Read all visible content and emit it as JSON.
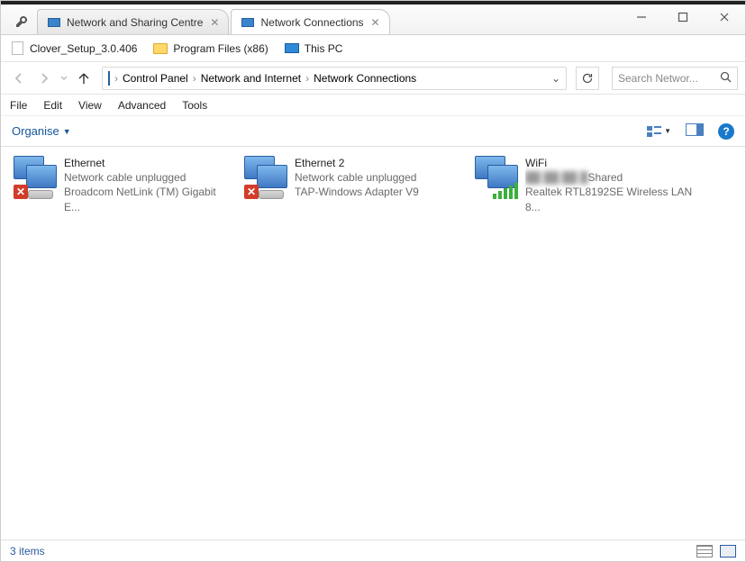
{
  "tabs": [
    {
      "label": "Network and Sharing Centre",
      "active": false
    },
    {
      "label": "Network Connections",
      "active": true
    }
  ],
  "bookmarks": [
    {
      "label": "Clover_Setup_3.0.406",
      "icon": "page"
    },
    {
      "label": "Program Files (x86)",
      "icon": "folder"
    },
    {
      "label": "This PC",
      "icon": "pc"
    }
  ],
  "breadcrumb": {
    "parts": [
      "Control Panel",
      "Network and Internet",
      "Network Connections"
    ]
  },
  "search": {
    "placeholder": "Search Networ..."
  },
  "menu": [
    "File",
    "Edit",
    "View",
    "Advanced",
    "Tools"
  ],
  "commandbar": {
    "organise": "Organise"
  },
  "help_symbol": "?",
  "connections": [
    {
      "name": "Ethernet",
      "status": "Network cable unplugged",
      "device": "Broadcom NetLink (TM) Gigabit E...",
      "state": "unplugged"
    },
    {
      "name": "Ethernet 2",
      "status": "Network cable unplugged",
      "device": "TAP-Windows Adapter V9",
      "state": "unplugged"
    },
    {
      "name": "WiFi",
      "status": "Shared",
      "status_redacted": true,
      "device": "Realtek RTL8192SE Wireless LAN 8...",
      "state": "wifi"
    }
  ],
  "status": {
    "text": "3 items"
  }
}
